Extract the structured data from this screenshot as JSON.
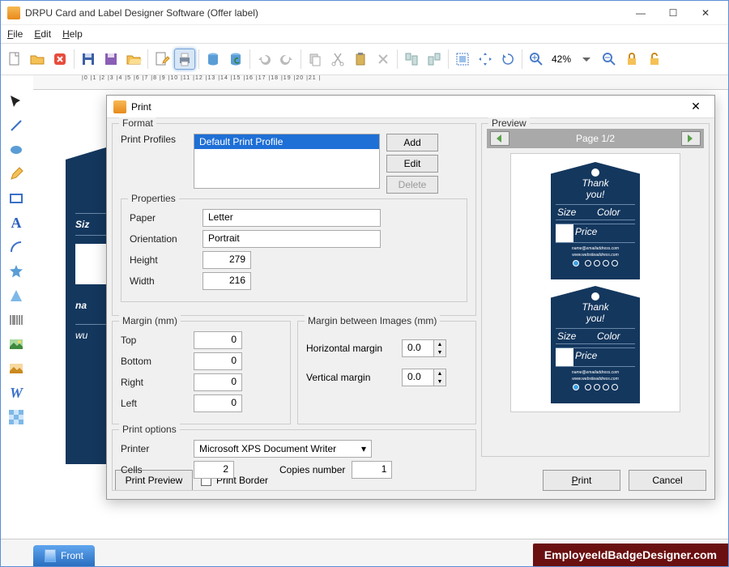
{
  "app": {
    "title": "DRPU Card and Label Designer Software (Offer label)"
  },
  "menu": {
    "file": "File",
    "edit": "Edit",
    "help": "Help"
  },
  "toolbar": {
    "zoom": "42%"
  },
  "tabs": {
    "front": "Front"
  },
  "watermark": "EmployeeIdBadgeDesigner.com",
  "ruler": "|0 |1 |2 |3 |4 |5 |6 |7 |8 |9 |10 |11 |12 |13 |14 |15 |16 |17 |18 |19 |20 |21 |",
  "canvas": {
    "size_label": "Siz",
    "name_label": "na",
    "web_label": "wu"
  },
  "dialog": {
    "title": "Print",
    "format": {
      "legend": "Format",
      "profiles_label": "Print Profiles",
      "selected_profile": "Default Print Profile",
      "add": "Add",
      "edit": "Edit",
      "delete": "Delete"
    },
    "properties": {
      "legend": "Properties",
      "paper_label": "Paper",
      "paper": "Letter",
      "orientation_label": "Orientation",
      "orientation": "Portrait",
      "height_label": "Height",
      "height": "279",
      "width_label": "Width",
      "width": "216"
    },
    "margin": {
      "legend": "Margin (mm)",
      "top_label": "Top",
      "top": "0",
      "bottom_label": "Bottom",
      "bottom": "0",
      "right_label": "Right",
      "right": "0",
      "left_label": "Left",
      "left": "0"
    },
    "margin_images": {
      "legend": "Margin between Images (mm)",
      "h_label": "Horizontal margin",
      "h": "0.0",
      "v_label": "Vertical margin",
      "v": "0.0"
    },
    "print_options": {
      "legend": "Print options",
      "printer_label": "Printer",
      "printer": "Microsoft XPS Document Writer",
      "cells_label": "Cells",
      "cells": "2",
      "copies_label": "Copies number",
      "copies": "1"
    },
    "footer": {
      "preview": "Print Preview",
      "border": "Print Border",
      "print": "Print",
      "cancel": "Cancel"
    },
    "preview": {
      "legend": "Preview",
      "page": "Page 1/2",
      "tag_title1": "Thank",
      "tag_title2": "you!",
      "size": "Size",
      "color": "Color",
      "price": "Price",
      "email": "name@emailaddress.com",
      "web": "www.websiteaddress.com"
    }
  }
}
